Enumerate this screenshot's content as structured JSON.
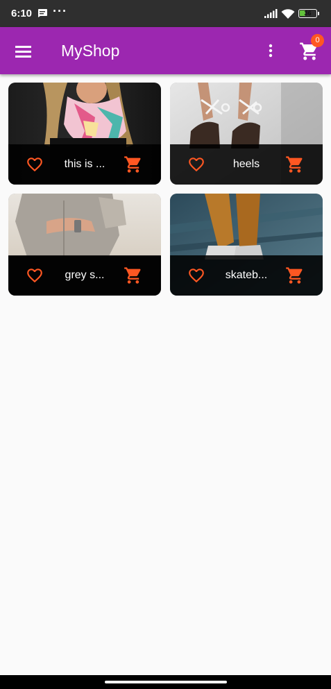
{
  "status_bar": {
    "time": "6:10",
    "more": "···",
    "battery_level": "36",
    "battery_fraction": 0.36
  },
  "app_bar": {
    "title": "MyShop",
    "cart_count": "0"
  },
  "products": [
    {
      "title": "this is ..."
    },
    {
      "title": "heels"
    },
    {
      "title": "grey s..."
    },
    {
      "title": "skateb..."
    }
  ],
  "colors": {
    "app_bar": "#9c27b0",
    "accent": "#ff5722",
    "status_bar": "#2f2f2f",
    "background": "#fafafa",
    "battery": "#63c23c"
  },
  "icons": {
    "menu": "menu-icon",
    "more": "more-vert-icon",
    "cart": "shopping-cart-icon",
    "favorite": "favorite-border-icon",
    "add_to_cart": "shopping-cart-icon"
  }
}
